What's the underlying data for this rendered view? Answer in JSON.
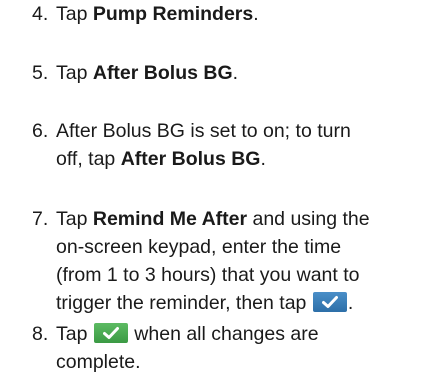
{
  "steps": [
    {
      "number": "4.",
      "pre": "Tap ",
      "bold": "Pump Reminders",
      "post": "."
    },
    {
      "number": "5.",
      "pre": "Tap ",
      "bold": "After Bolus BG",
      "post": "."
    },
    {
      "number": "6.",
      "line1": "After Bolus BG is set to on; to turn",
      "line2_pre": "off, tap ",
      "line2_bold": "After Bolus BG",
      "line2_post": "."
    },
    {
      "number": "7.",
      "line1_pre": "Tap ",
      "line1_bold": "Remind Me After",
      "line1_post": " and using the",
      "line2": "on-screen keypad, enter the time",
      "line3": "(from 1 to 3 hours) that you want to",
      "line4_pre": "trigger the reminder, then tap",
      "line4_post": ".",
      "icon": "checkmark-button-blue-icon"
    },
    {
      "number": "8.",
      "line1_pre": "Tap",
      "line1_post": "when all changes are",
      "line2": "complete.",
      "icon": "checkmark-button-green-icon"
    }
  ],
  "colors": {
    "text": "#1a1a1a",
    "blue_button": "#3a7fbd",
    "green_button": "#4caf50"
  }
}
